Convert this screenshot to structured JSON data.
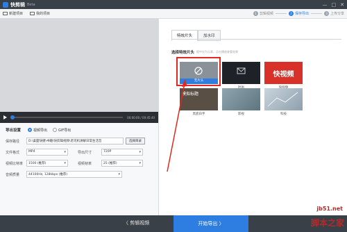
{
  "titlebar": {
    "app_title": "快剪辑",
    "beta": "Beta",
    "controls": [
      "—",
      "□",
      "✕"
    ]
  },
  "toolbar": {
    "new_project": "新建项目",
    "my_projects": "我的项目",
    "steps": [
      {
        "num": "1",
        "label": "剪辑视频"
      },
      {
        "num": "2",
        "label": "保存导出"
      },
      {
        "num": "3",
        "label": "上传分享"
      }
    ]
  },
  "player": {
    "time": "00:00:00 / 00:45:40",
    "progress": 0.02
  },
  "export": {
    "title": "导出设置",
    "video_option": "视频导出",
    "gif_option": "GIF导出",
    "save_path_label": "保存路径",
    "save_path_value": "D:\\桌面快捷\\书籍\\快剪辑视频\\老司机讲解日常生活哲",
    "browse_label": "选择目录",
    "format_label": "文件格式",
    "format_value": "MP4",
    "size_label": "导出尺寸",
    "size_value": "720P",
    "bitrate_label": "视频比特率",
    "bitrate_value": "1500 (推荐)",
    "framerate_label": "视频帧率",
    "framerate_value": "25 (推荐)",
    "audio_label": "音频质量",
    "audio_value": "44100Hz, 128kbps (推荐)"
  },
  "effects": {
    "tabs": [
      "特效片头",
      "加水印"
    ],
    "section_title": "选择特效片头",
    "section_hint": "图中仅为示意，点击播放查看效果",
    "items": [
      {
        "caption": "无片头",
        "thumb_text": ""
      },
      {
        "caption": "时尚",
        "thumb_text": ""
      },
      {
        "caption": "快视频",
        "thumb_text": "快视频"
      },
      {
        "caption": "黑底白字",
        "thumb_text": "模拟标题"
      },
      {
        "caption": "影视",
        "thumb_text": ""
      },
      {
        "caption": "科技",
        "thumb_text": ""
      }
    ]
  },
  "bottom": {
    "back_label": "〈  剪辑视频",
    "export_label": "开始导出  〉"
  },
  "watermark": {
    "line1": "jb51.net",
    "line2": "脚本之家"
  },
  "colors": {
    "accent": "#2e7de1",
    "highlight": "#e0281e"
  }
}
